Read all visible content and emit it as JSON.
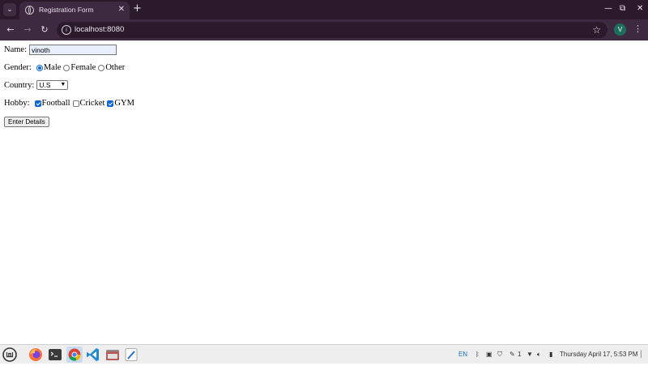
{
  "browser": {
    "tab_list_icon": "chevron-down-icon",
    "tab": {
      "title": "Registration Form",
      "favicon": "globe-icon",
      "close": "✕"
    },
    "new_tab": "+",
    "window_controls": {
      "minimize": "—",
      "maximize": "⧉",
      "close": "✕"
    },
    "nav": {
      "back": "←",
      "forward": "→",
      "reload": "↻"
    },
    "address_bar": {
      "site_info": "i",
      "url": "localhost:8080",
      "bookmark": "☆"
    },
    "profile_initial": "V",
    "menu": "⋮"
  },
  "form": {
    "name": {
      "label": "Name:",
      "value": "vinoth"
    },
    "gender": {
      "label": "Gender:",
      "options": [
        {
          "label": "Male",
          "checked": true
        },
        {
          "label": "Female",
          "checked": false
        },
        {
          "label": "Other",
          "checked": false
        }
      ]
    },
    "country": {
      "label": "Country:",
      "selected": "U.S"
    },
    "hobby": {
      "label": "Hobby:",
      "options": [
        {
          "label": "Football",
          "checked": true
        },
        {
          "label": "Cricket",
          "checked": false
        },
        {
          "label": "GYM",
          "checked": true
        }
      ]
    },
    "submit_label": "Enter Details"
  },
  "taskbar": {
    "apps": [
      "mint-menu-icon",
      "firefox-icon",
      "terminal-icon",
      "chrome-icon",
      "vscode-icon",
      "files-icon",
      "text-editor-icon"
    ],
    "tray": {
      "language": "EN",
      "notification_count": "1",
      "clock": "Thursday April 17, 5:53 PM"
    },
    "accent_color": "#0a66d8",
    "language_color": "#1a73c8"
  }
}
